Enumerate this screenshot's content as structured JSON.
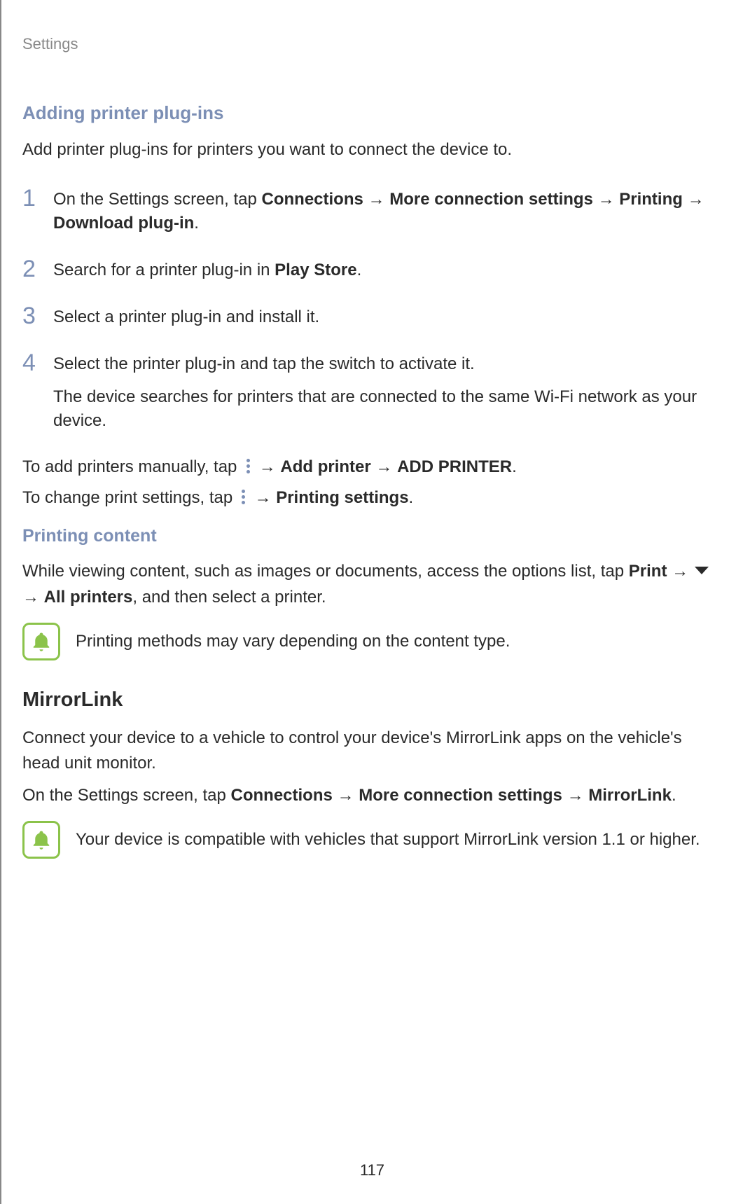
{
  "header": "Settings",
  "section1": {
    "heading": "Adding printer plug-ins",
    "intro": "Add printer plug-ins for printers you want to connect the device to.",
    "steps": [
      {
        "num": "1",
        "pre": "On the Settings screen, tap ",
        "b1": "Connections",
        "a1": " → ",
        "b2": "More connection settings",
        "a2": " → ",
        "b3": "Printing",
        "a3": " → ",
        "b4": "Download plug-in",
        "post": "."
      },
      {
        "num": "2",
        "pre": "Search for a printer plug-in in ",
        "b1": "Play Store",
        "post": "."
      },
      {
        "num": "3",
        "text": "Select a printer plug-in and install it."
      },
      {
        "num": "4",
        "text": "Select the printer plug-in and tap the switch to activate it.",
        "extra": "The device searches for printers that are connected to the same Wi-Fi network as your device."
      }
    ],
    "manual": {
      "pre": "To add printers manually, tap ",
      "a1": " → ",
      "b1": "Add printer",
      "a2": " → ",
      "b2": "ADD PRINTER",
      "post": "."
    },
    "settings": {
      "pre": "To change print settings, tap ",
      "a1": " → ",
      "b1": "Printing settings",
      "post": "."
    }
  },
  "section2": {
    "heading": "Printing content",
    "body": {
      "pre": "While viewing content, such as images or documents, access the options list, tap ",
      "b1": "Print",
      "a1": " → ",
      "a2": " → ",
      "b2": "All printers",
      "post": ", and then select a printer."
    },
    "note": "Printing methods may vary depending on the content type."
  },
  "section3": {
    "title": "MirrorLink",
    "intro": "Connect your device to a vehicle to control your device's MirrorLink apps on the vehicle's head unit monitor.",
    "path": {
      "pre": "On the Settings screen, tap ",
      "b1": "Connections",
      "a1": " → ",
      "b2": "More connection settings",
      "a2": " → ",
      "b3": "MirrorLink",
      "post": "."
    },
    "note": "Your device is compatible with vehicles that support MirrorLink version 1.1 or higher."
  },
  "pageNumber": "117"
}
